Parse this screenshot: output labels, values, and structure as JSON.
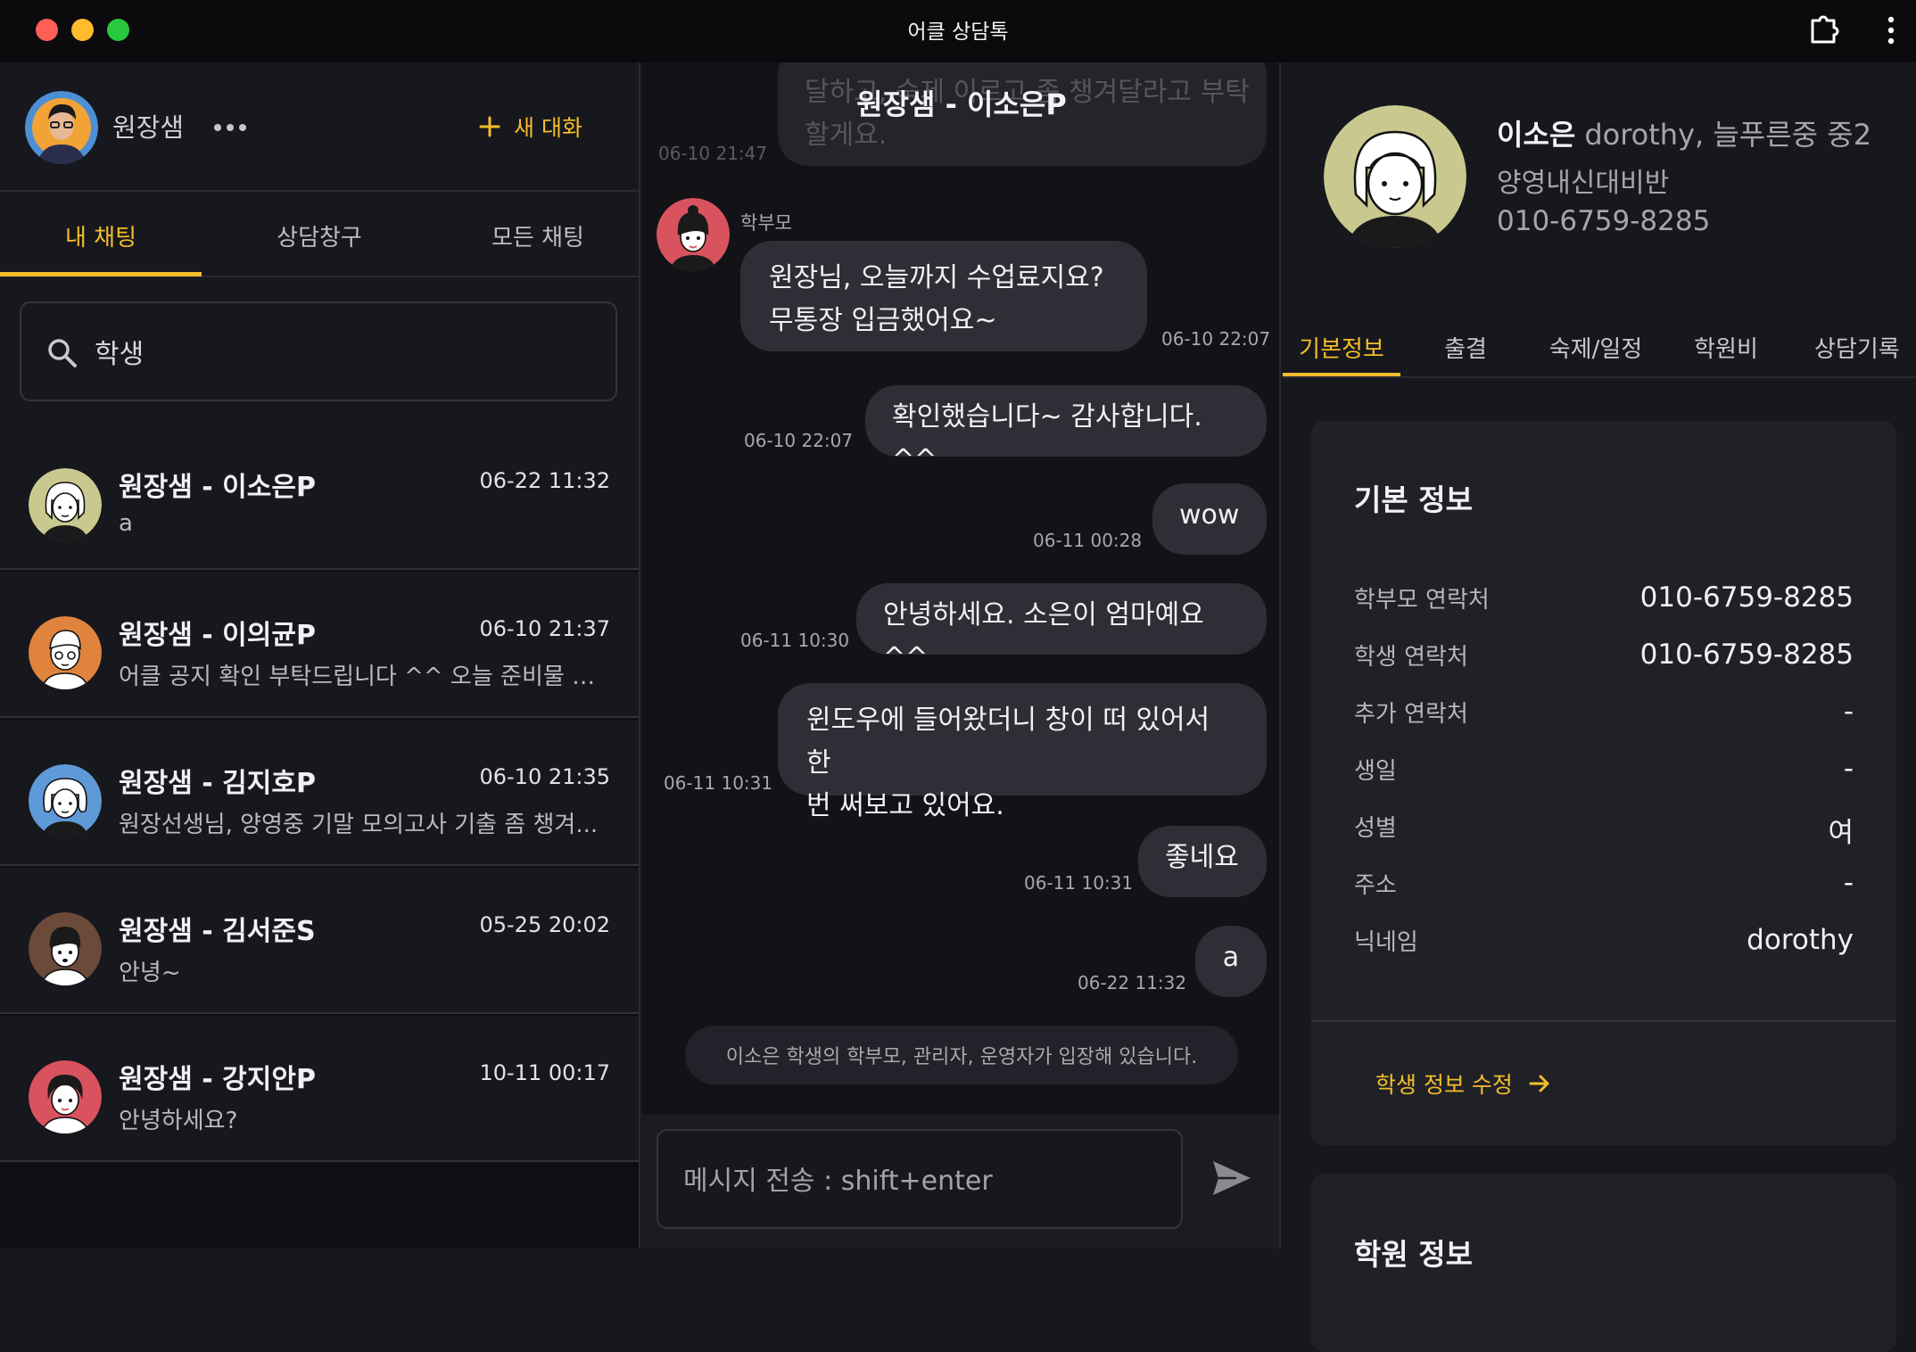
{
  "window": {
    "title": "어클 상담톡"
  },
  "sidebar": {
    "user_name": "원장샘",
    "new_chat_label": "새 대화",
    "tabs": [
      {
        "label": "내 채팅",
        "active": true
      },
      {
        "label": "상담창구",
        "active": false
      },
      {
        "label": "모든 채팅",
        "active": false
      }
    ],
    "search": {
      "value": "학생",
      "placeholder": ""
    },
    "chats": [
      {
        "name": "원장샘 - 이소은P",
        "time": "06-22 11:32",
        "preview": "a"
      },
      {
        "name": "원장샘 - 이의균P",
        "time": "06-10 21:37",
        "preview": "어클 공지 확인 부탁드립니다 ^^ 오늘 준비물 여..."
      },
      {
        "name": "원장샘 - 김지호P",
        "time": "06-10 21:35",
        "preview": "원장선생님, 양영중 기말 모의고사 기출 좀 챙겨..."
      },
      {
        "name": "원장샘 - 김서준S",
        "time": "05-25 20:02",
        "preview": "안녕~"
      },
      {
        "name": "원장샘 - 강지안P",
        "time": "10-11 00:17",
        "preview": "안녕하세요?"
      }
    ]
  },
  "conversation": {
    "title": "원장샘 - 이소은P",
    "faded_message": {
      "text": "달하고, 숙제 이르고 좀 챙겨달라고 부탁할게요.",
      "time": "06-10 21:47"
    },
    "sender_label": "학부모",
    "messages": [
      {
        "side": "incoming",
        "text": "원장님, 오늘까지 수업료지요?\n무통장 입금했어요~",
        "time": "06-10 22:07"
      },
      {
        "side": "outgoing",
        "text": "확인했습니다~ 감사합니다. ^^",
        "time": "06-10 22:07"
      },
      {
        "side": "outgoing",
        "text": "wow",
        "time": "06-11 00:28"
      },
      {
        "side": "outgoing",
        "text": "안녕하세요. 소은이 엄마예요^^",
        "time": "06-11 10:30"
      },
      {
        "side": "outgoing",
        "text": "윈도우에 들어왔더니 창이 떠 있어서 한\n번 써보고 있어요.",
        "time": "06-11 10:31"
      },
      {
        "side": "outgoing",
        "text": "좋네요",
        "time": "06-11 10:31"
      },
      {
        "side": "outgoing",
        "text": "a",
        "time": "06-22 11:32"
      }
    ],
    "system_notice": "이소은 학생의 학부모, 관리자, 운영자가 입장해 있습니다.",
    "composer": {
      "placeholder": "메시지 전송 : shift+enter",
      "value": ""
    }
  },
  "profile": {
    "name": "이소은",
    "subtitle": "dorothy, 늘푸른중 중2",
    "class_name": "양영내신대비반",
    "phone": "010-6759-8285",
    "tabs": [
      {
        "label": "기본정보",
        "active": true
      },
      {
        "label": "출결",
        "active": false
      },
      {
        "label": "숙제/일정",
        "active": false
      },
      {
        "label": "학원비",
        "active": false
      },
      {
        "label": "상담기록",
        "active": false
      }
    ],
    "basic_info": {
      "title": "기본 정보",
      "rows": [
        {
          "label": "학부모 연락처",
          "value": "010-6759-8285"
        },
        {
          "label": "학생 연락처",
          "value": "010-6759-8285"
        },
        {
          "label": "추가 연락처",
          "value": "-"
        },
        {
          "label": "생일",
          "value": "-"
        },
        {
          "label": "성별",
          "value": "여"
        },
        {
          "label": "주소",
          "value": "-"
        },
        {
          "label": "닉네임",
          "value": "dorothy"
        }
      ],
      "edit_label": "학생 정보 수정"
    },
    "second_card_title": "학원 정보"
  },
  "colors": {
    "accent": "#f5bd2b",
    "background": "#17181d",
    "bubble": "#2e2f36",
    "panel_card": "#202127"
  }
}
